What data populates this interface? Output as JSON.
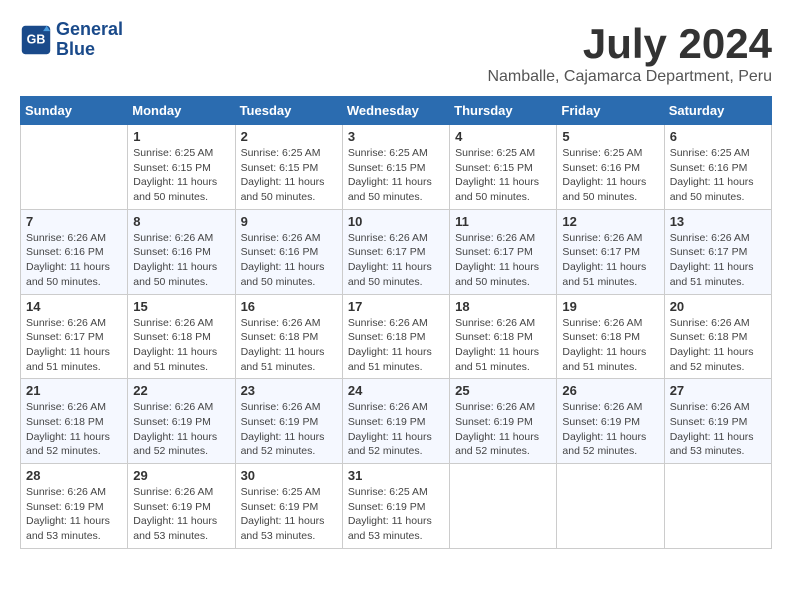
{
  "logo": {
    "line1": "General",
    "line2": "Blue"
  },
  "title": "July 2024",
  "location": "Namballe, Cajamarca Department, Peru",
  "days_of_week": [
    "Sunday",
    "Monday",
    "Tuesday",
    "Wednesday",
    "Thursday",
    "Friday",
    "Saturday"
  ],
  "weeks": [
    [
      {
        "day": "",
        "sunrise": "",
        "sunset": "",
        "daylight": ""
      },
      {
        "day": "1",
        "sunrise": "6:25 AM",
        "sunset": "6:15 PM",
        "daylight": "11 hours and 50 minutes."
      },
      {
        "day": "2",
        "sunrise": "6:25 AM",
        "sunset": "6:15 PM",
        "daylight": "11 hours and 50 minutes."
      },
      {
        "day": "3",
        "sunrise": "6:25 AM",
        "sunset": "6:15 PM",
        "daylight": "11 hours and 50 minutes."
      },
      {
        "day": "4",
        "sunrise": "6:25 AM",
        "sunset": "6:15 PM",
        "daylight": "11 hours and 50 minutes."
      },
      {
        "day": "5",
        "sunrise": "6:25 AM",
        "sunset": "6:16 PM",
        "daylight": "11 hours and 50 minutes."
      },
      {
        "day": "6",
        "sunrise": "6:25 AM",
        "sunset": "6:16 PM",
        "daylight": "11 hours and 50 minutes."
      }
    ],
    [
      {
        "day": "7",
        "sunrise": "6:26 AM",
        "sunset": "6:16 PM",
        "daylight": "11 hours and 50 minutes."
      },
      {
        "day": "8",
        "sunrise": "6:26 AM",
        "sunset": "6:16 PM",
        "daylight": "11 hours and 50 minutes."
      },
      {
        "day": "9",
        "sunrise": "6:26 AM",
        "sunset": "6:16 PM",
        "daylight": "11 hours and 50 minutes."
      },
      {
        "day": "10",
        "sunrise": "6:26 AM",
        "sunset": "6:17 PM",
        "daylight": "11 hours and 50 minutes."
      },
      {
        "day": "11",
        "sunrise": "6:26 AM",
        "sunset": "6:17 PM",
        "daylight": "11 hours and 50 minutes."
      },
      {
        "day": "12",
        "sunrise": "6:26 AM",
        "sunset": "6:17 PM",
        "daylight": "11 hours and 51 minutes."
      },
      {
        "day": "13",
        "sunrise": "6:26 AM",
        "sunset": "6:17 PM",
        "daylight": "11 hours and 51 minutes."
      }
    ],
    [
      {
        "day": "14",
        "sunrise": "6:26 AM",
        "sunset": "6:17 PM",
        "daylight": "11 hours and 51 minutes."
      },
      {
        "day": "15",
        "sunrise": "6:26 AM",
        "sunset": "6:18 PM",
        "daylight": "11 hours and 51 minutes."
      },
      {
        "day": "16",
        "sunrise": "6:26 AM",
        "sunset": "6:18 PM",
        "daylight": "11 hours and 51 minutes."
      },
      {
        "day": "17",
        "sunrise": "6:26 AM",
        "sunset": "6:18 PM",
        "daylight": "11 hours and 51 minutes."
      },
      {
        "day": "18",
        "sunrise": "6:26 AM",
        "sunset": "6:18 PM",
        "daylight": "11 hours and 51 minutes."
      },
      {
        "day": "19",
        "sunrise": "6:26 AM",
        "sunset": "6:18 PM",
        "daylight": "11 hours and 51 minutes."
      },
      {
        "day": "20",
        "sunrise": "6:26 AM",
        "sunset": "6:18 PM",
        "daylight": "11 hours and 52 minutes."
      }
    ],
    [
      {
        "day": "21",
        "sunrise": "6:26 AM",
        "sunset": "6:18 PM",
        "daylight": "11 hours and 52 minutes."
      },
      {
        "day": "22",
        "sunrise": "6:26 AM",
        "sunset": "6:19 PM",
        "daylight": "11 hours and 52 minutes."
      },
      {
        "day": "23",
        "sunrise": "6:26 AM",
        "sunset": "6:19 PM",
        "daylight": "11 hours and 52 minutes."
      },
      {
        "day": "24",
        "sunrise": "6:26 AM",
        "sunset": "6:19 PM",
        "daylight": "11 hours and 52 minutes."
      },
      {
        "day": "25",
        "sunrise": "6:26 AM",
        "sunset": "6:19 PM",
        "daylight": "11 hours and 52 minutes."
      },
      {
        "day": "26",
        "sunrise": "6:26 AM",
        "sunset": "6:19 PM",
        "daylight": "11 hours and 52 minutes."
      },
      {
        "day": "27",
        "sunrise": "6:26 AM",
        "sunset": "6:19 PM",
        "daylight": "11 hours and 53 minutes."
      }
    ],
    [
      {
        "day": "28",
        "sunrise": "6:26 AM",
        "sunset": "6:19 PM",
        "daylight": "11 hours and 53 minutes."
      },
      {
        "day": "29",
        "sunrise": "6:26 AM",
        "sunset": "6:19 PM",
        "daylight": "11 hours and 53 minutes."
      },
      {
        "day": "30",
        "sunrise": "6:25 AM",
        "sunset": "6:19 PM",
        "daylight": "11 hours and 53 minutes."
      },
      {
        "day": "31",
        "sunrise": "6:25 AM",
        "sunset": "6:19 PM",
        "daylight": "11 hours and 53 minutes."
      },
      {
        "day": "",
        "sunrise": "",
        "sunset": "",
        "daylight": ""
      },
      {
        "day": "",
        "sunrise": "",
        "sunset": "",
        "daylight": ""
      },
      {
        "day": "",
        "sunrise": "",
        "sunset": "",
        "daylight": ""
      }
    ]
  ]
}
